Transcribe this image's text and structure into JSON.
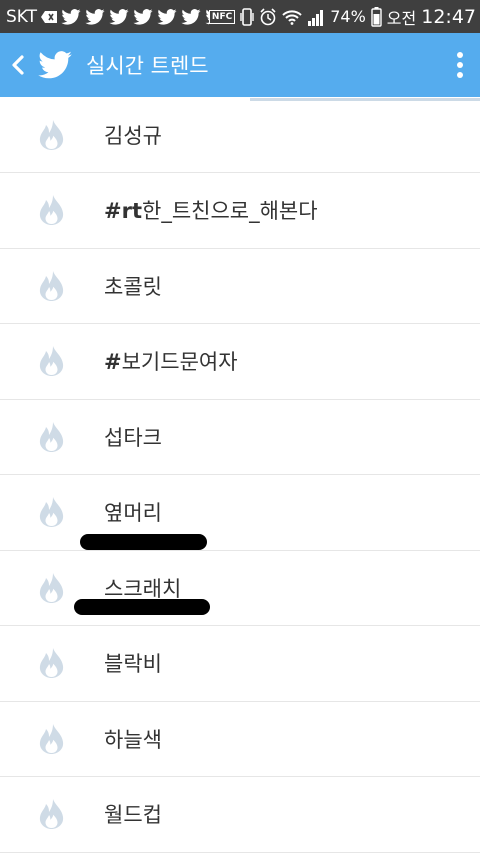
{
  "status_bar": {
    "carrier": "SKT",
    "battery_percent": "74%",
    "ampm": "오전",
    "time": "12:47",
    "nfc_label": "NFC"
  },
  "app_bar": {
    "title": "실시간 트렌드",
    "background": "#55acee"
  },
  "loading_progress": 0.48,
  "trends": [
    {
      "label": "김성규"
    },
    {
      "label": "#rt한_트친으로_해본다",
      "hashtag": true,
      "prefix": "#rt",
      "rest": "한_트친으로_해본다"
    },
    {
      "label": "초콜릿"
    },
    {
      "label": "#보기드문여자",
      "hashtag": true,
      "prefix": "#",
      "rest": "보기드문여자"
    },
    {
      "label": "섭타크"
    },
    {
      "label": "옆머리"
    },
    {
      "label": "스크래치"
    },
    {
      "label": "블락비"
    },
    {
      "label": "하늘색"
    },
    {
      "label": "월드컵"
    }
  ]
}
